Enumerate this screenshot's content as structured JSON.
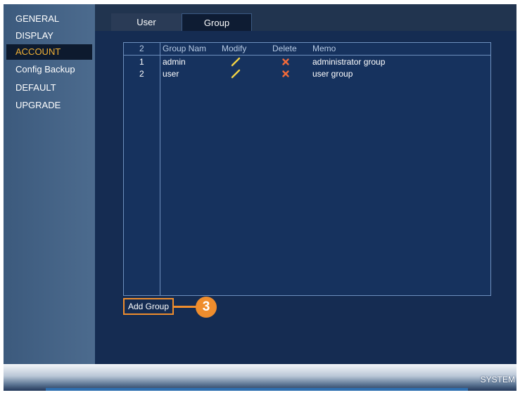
{
  "sidebar": {
    "items": [
      {
        "label": "GENERAL",
        "active": false
      },
      {
        "label": "DISPLAY",
        "active": false
      },
      {
        "label": "ACCOUNT",
        "active": true
      },
      {
        "label": "Config Backup",
        "active": false
      },
      {
        "label": "DEFAULT",
        "active": false
      },
      {
        "label": "UPGRADE",
        "active": false
      }
    ]
  },
  "tabs": {
    "user": "User",
    "group": "Group",
    "selected": "Group"
  },
  "table": {
    "headers": {
      "count": "2",
      "group_name": "Group Nam",
      "modify": "Modify",
      "delete": "Delete",
      "memo": "Memo"
    },
    "rows": [
      {
        "index": "1",
        "group_name": "admin",
        "memo": "administrator group"
      },
      {
        "index": "2",
        "group_name": "user",
        "memo": "user group"
      }
    ]
  },
  "actions": {
    "add_group": "Add Group"
  },
  "callout": {
    "number": "3"
  },
  "footer": {
    "section": "SYSTEM"
  },
  "colors": {
    "accent": "#f2b135",
    "callout": "#ef8d2d",
    "modify_icon": "#f2d244",
    "delete_icon": "#f06a3a"
  },
  "icons": {
    "modify": "pencil-icon",
    "delete": "x-mark-icon"
  }
}
